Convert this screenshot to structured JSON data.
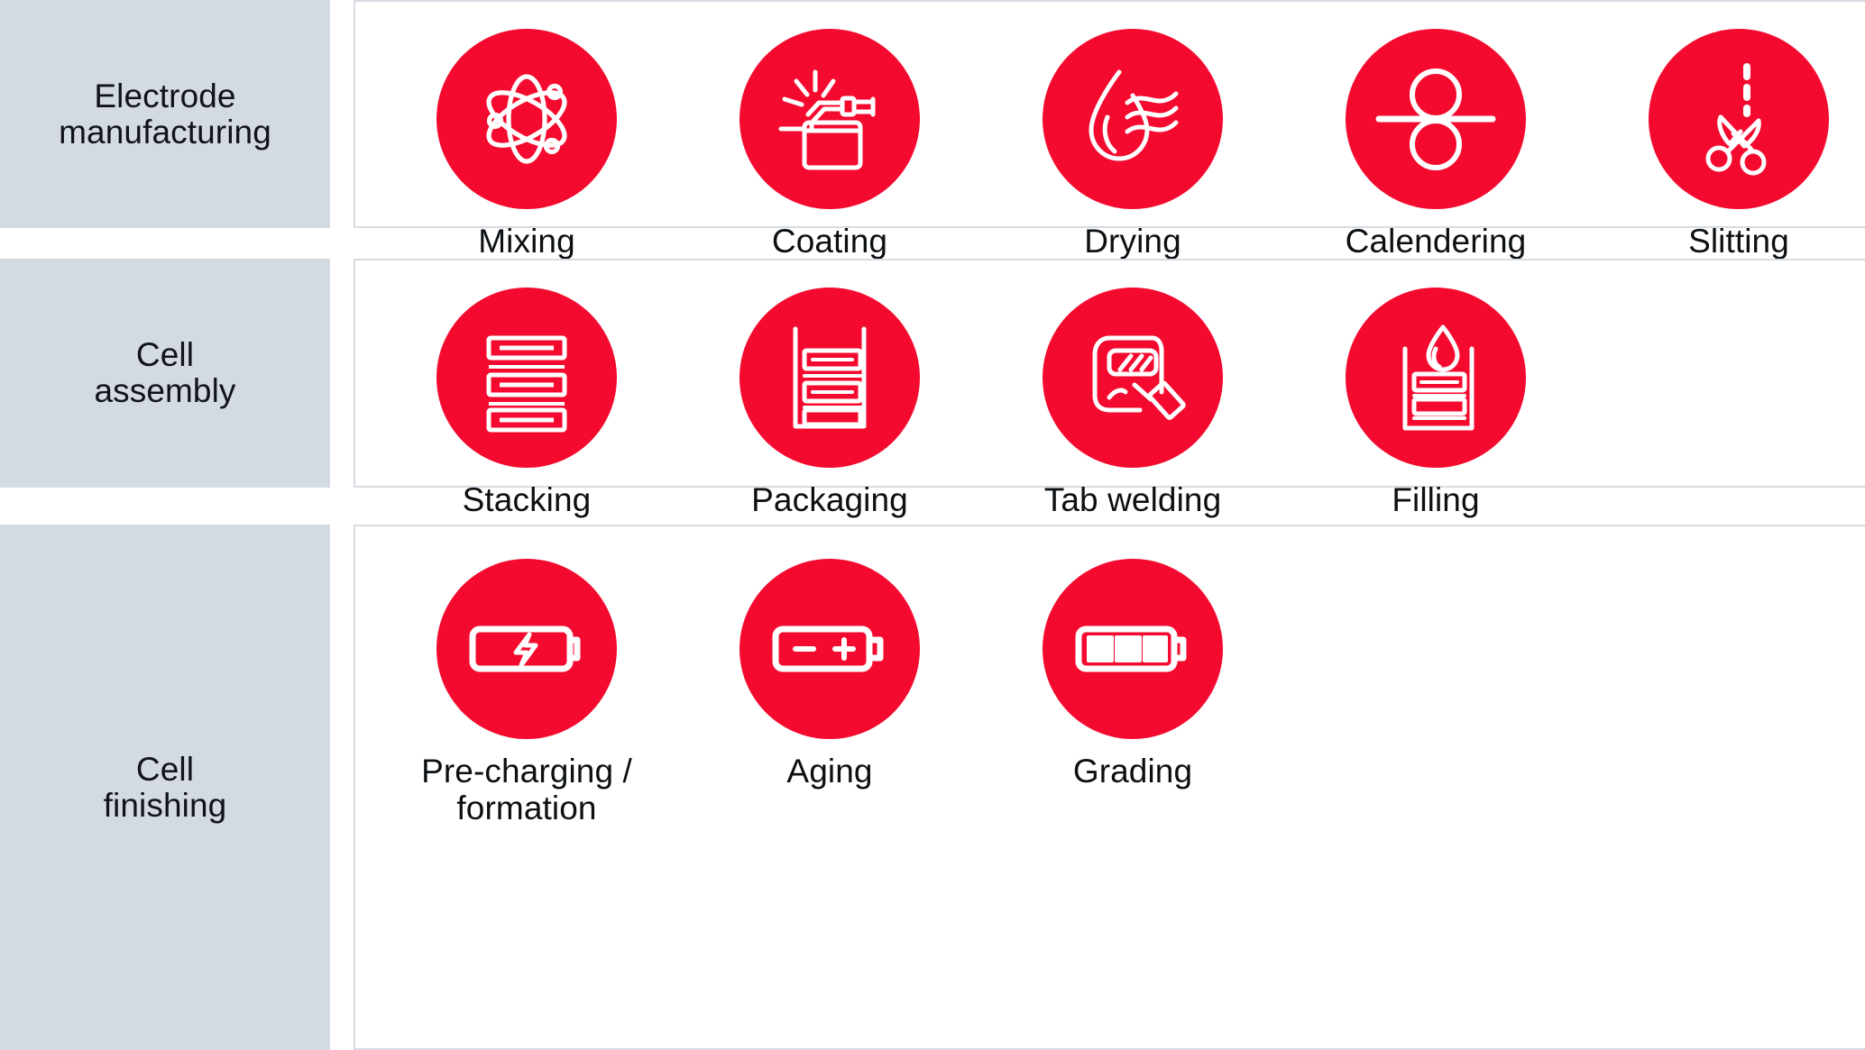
{
  "theme": {
    "accent_red": "#F40A2E",
    "label_panel_bg": "#D4DAE1",
    "panel_border": "#D6DBE2",
    "text_color": "#0C1013",
    "page_bg": "#FFFFFF"
  },
  "rows": [
    {
      "label": "Electrode\nmanufacturing",
      "label_lines": [
        "Electrode",
        "manufacturing"
      ],
      "stages": [
        {
          "name": "Mixing",
          "icon": "atom-icon"
        },
        {
          "name": "Coating",
          "icon": "spray-torch-tray-icon"
        },
        {
          "name": "Drying",
          "icon": "droplet-air-waves-icon"
        },
        {
          "name": "Calendering",
          "icon": "roller-press-icon"
        },
        {
          "name": "Slitting",
          "icon": "scissors-dashed-line-icon"
        }
      ]
    },
    {
      "label": "Cell\nassembly",
      "label_lines": [
        "Cell",
        "assembly"
      ],
      "stages": [
        {
          "name": "Stacking",
          "icon": "stacked-layers-icon"
        },
        {
          "name": "Packaging",
          "icon": "layers-in-casing-icon"
        },
        {
          "name": "Tab welding",
          "icon": "cell-welding-tool-icon"
        },
        {
          "name": "Filling",
          "icon": "droplet-into-casing-icon"
        }
      ]
    },
    {
      "label": "Cell\nfinishing",
      "label_lines": [
        "Cell",
        "finishing"
      ],
      "stages": [
        {
          "name": "Pre-charging /\nformation",
          "icon": "battery-bolt-icon"
        },
        {
          "name": "Aging",
          "icon": "battery-plus-minus-icon"
        },
        {
          "name": "Grading",
          "icon": "battery-bars-icon"
        }
      ]
    }
  ]
}
